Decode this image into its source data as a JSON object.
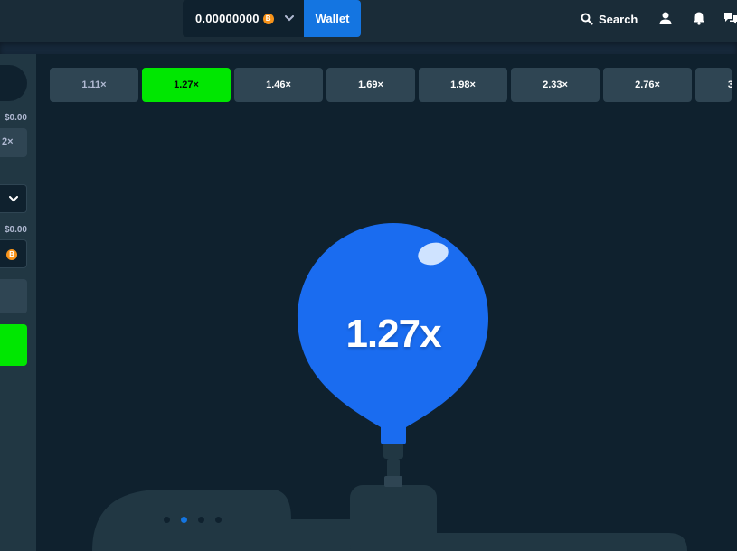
{
  "header": {
    "balance": "0.00000000",
    "currency_icon": "btc-coin-icon",
    "currency_symbol": "B",
    "wallet_label": "Wallet",
    "search_label": "Search",
    "icons": [
      "search-icon",
      "user-icon",
      "bell-icon",
      "chat-icon"
    ]
  },
  "sidebar": {
    "amount_top": "$0.00",
    "multiplier_value": "2×",
    "amount_bottom": "$0.00",
    "currency_symbol": "B"
  },
  "multipliers": [
    {
      "label": "1.11×",
      "state": "dim"
    },
    {
      "label": "1.27×",
      "state": "active"
    },
    {
      "label": "1.46×",
      "state": "normal"
    },
    {
      "label": "1.69×",
      "state": "normal"
    },
    {
      "label": "1.98×",
      "state": "normal"
    },
    {
      "label": "2.33×",
      "state": "normal"
    },
    {
      "label": "2.76×",
      "state": "normal"
    },
    {
      "label": "3",
      "state": "normal"
    }
  ],
  "balloon": {
    "multiplier": "1.27x",
    "color": "#1a6cf0"
  },
  "colors": {
    "accent_green": "#00e701",
    "accent_blue": "#1475e1",
    "background": "#0f212e",
    "panel": "#213743"
  }
}
